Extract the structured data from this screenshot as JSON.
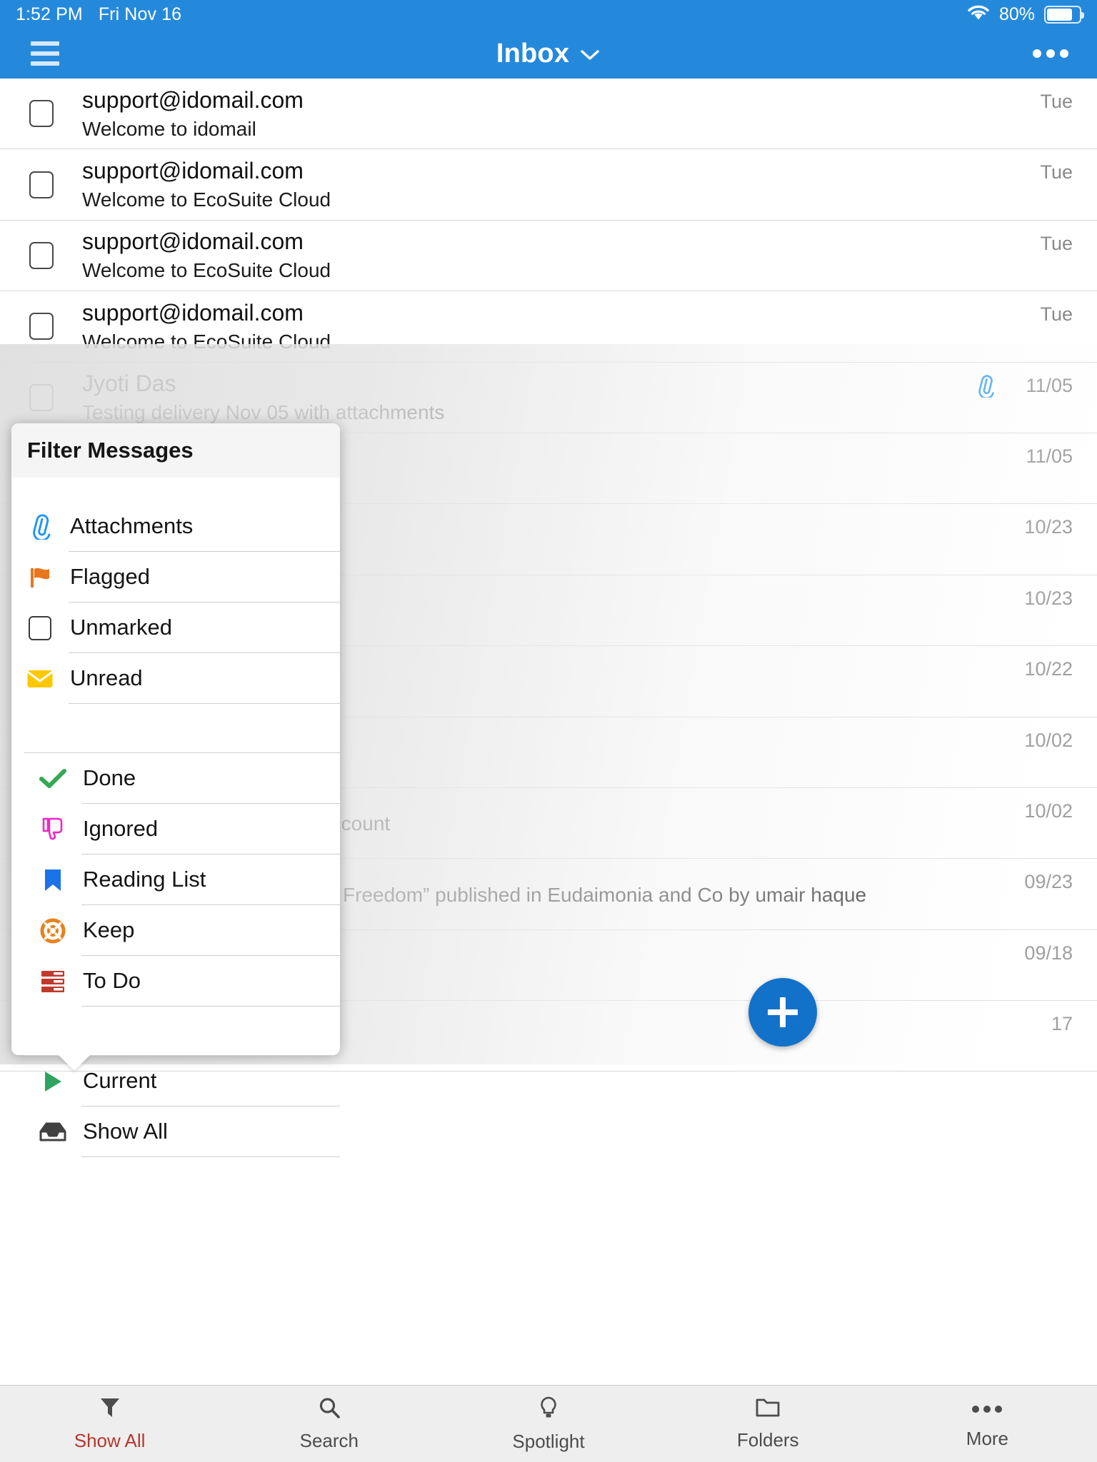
{
  "status_bar": {
    "time": "1:52 PM",
    "date": "Fri Nov 16",
    "battery_percent": "80%",
    "wifi_icon": "wifi-icon",
    "battery_icon": "battery-icon"
  },
  "nav": {
    "menu_icon": "hamburger-menu-icon",
    "title": "Inbox",
    "title_chevron": "chevron-down-icon",
    "overflow_icon": "more-options-icon"
  },
  "mail_list": [
    {
      "from": "support@idomail.com",
      "subject": "Welcome to idomail",
      "date": "Tue",
      "attachment": false
    },
    {
      "from": "support@idomail.com",
      "subject": "Welcome to EcoSuite Cloud",
      "date": "Tue",
      "attachment": false
    },
    {
      "from": "support@idomail.com",
      "subject": "Welcome to EcoSuite Cloud",
      "date": "Tue",
      "attachment": false
    },
    {
      "from": "support@idomail.com",
      "subject": "Welcome to EcoSuite Cloud",
      "date": "Tue",
      "attachment": false
    },
    {
      "from": "Jyoti Das",
      "subject": "Testing delivery Nov 05 with attachments",
      "date": "11/05",
      "attachment": true
    },
    {
      "from": "",
      "subject": "",
      "date": "11/05",
      "attachment": false
    },
    {
      "from": "",
      "subject": "",
      "date": "10/23",
      "attachment": false
    },
    {
      "from": "",
      "subject": "",
      "date": "10/23",
      "attachment": false
    },
    {
      "from": "",
      "subject": "",
      "date": "10/22",
      "attachment": false
    },
    {
      "from": "",
      "subject": "",
      "date": "10/02",
      "attachment": false
    },
    {
      "from": "",
      "subject": "Account",
      "date": "10/02",
      "attachment": false
    },
    {
      "from": "",
      "subject": "Freedom” published in Eudaimonia and Co by umair haque",
      "date": "09/23",
      "attachment": false
    },
    {
      "from": "",
      "subject": "",
      "date": "09/18",
      "attachment": false
    },
    {
      "from": "",
      "subject": "",
      "date": "17",
      "attachment": false
    }
  ],
  "compose_button": {
    "icon": "plus-icon",
    "color": "#1272ca"
  },
  "filter_popup": {
    "title": "Filter Messages",
    "groups": [
      {
        "items": [
          {
            "label": "Attachments",
            "icon": "paperclip-icon",
            "color": "#2196f3"
          },
          {
            "label": "Flagged",
            "icon": "flag-icon",
            "color": "#e8761b"
          },
          {
            "label": "Unmarked",
            "icon": "empty-checkbox-icon",
            "color": "#3b3b3b"
          },
          {
            "label": "Unread",
            "icon": "envelope-icon",
            "color": "#fdc800"
          }
        ]
      },
      {
        "items": [
          {
            "label": "Done",
            "icon": "checkmark-icon",
            "color": "#34a853"
          },
          {
            "label": "Ignored",
            "icon": "thumbs-down-icon",
            "color": "#ef26c8"
          },
          {
            "label": "Reading List",
            "icon": "bookmark-icon",
            "color": "#1a73e8"
          },
          {
            "label": "Keep",
            "icon": "lifebuoy-icon",
            "color": "#e8821b"
          },
          {
            "label": "To Do",
            "icon": "todo-list-icon",
            "color": "#c0392b"
          }
        ]
      },
      {
        "items": [
          {
            "label": "Current",
            "icon": "play-triangle-icon",
            "color": "#2fa360"
          },
          {
            "label": "Show All",
            "icon": "inbox-tray-icon",
            "color": "#414141"
          }
        ]
      }
    ]
  },
  "tab_bar": {
    "active": "Show All",
    "active_color": "#b5372c",
    "tabs": [
      {
        "label": "Show All",
        "icon": "filter-funnel-icon"
      },
      {
        "label": "Search",
        "icon": "search-icon"
      },
      {
        "label": "Spotlight",
        "icon": "lightbulb-icon"
      },
      {
        "label": "Folders",
        "icon": "folder-icon"
      },
      {
        "label": "More",
        "icon": "more-dots-icon"
      }
    ]
  }
}
